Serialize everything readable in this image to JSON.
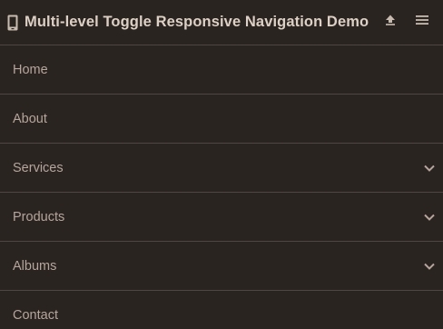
{
  "header": {
    "title": "Multi-level Toggle Responsive Navigation Demo",
    "icons": {
      "brand": "mobile-phone-icon",
      "upload": "upload-icon",
      "menu": "hamburger-menu-icon"
    }
  },
  "colors": {
    "background": "#2a2421",
    "divider": "#4e4643",
    "title": "#ddd0c4",
    "link": "#b6a59a",
    "icon": "#c8bbaf"
  },
  "nav": {
    "items": [
      {
        "label": "Home",
        "has_submenu": false
      },
      {
        "label": "About",
        "has_submenu": false
      },
      {
        "label": "Services",
        "has_submenu": true,
        "icon": "chevron-down-icon"
      },
      {
        "label": "Products",
        "has_submenu": true,
        "icon": "chevron-down-icon"
      },
      {
        "label": "Albums",
        "has_submenu": true,
        "icon": "chevron-down-icon"
      },
      {
        "label": "Contact",
        "has_submenu": false
      }
    ]
  }
}
